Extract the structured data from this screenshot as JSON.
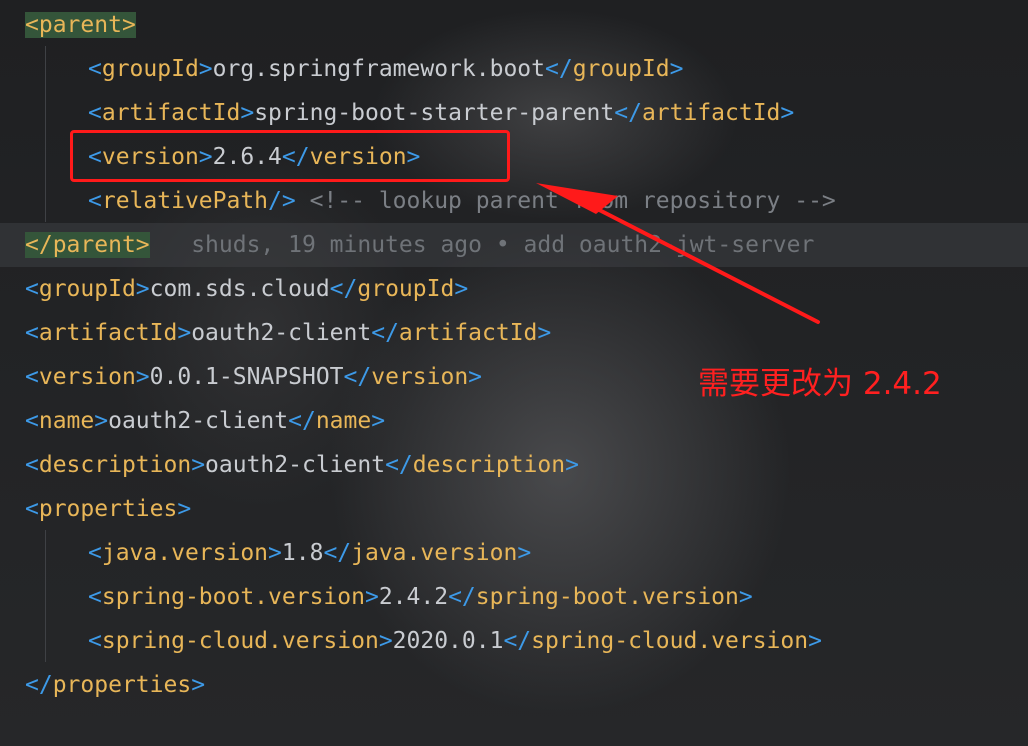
{
  "code_lines": [
    {
      "id": "parent-open",
      "indent": 0,
      "parts": [
        {
          "c": "br-y hl",
          "t": "<"
        },
        {
          "c": "tag hl",
          "t": "parent"
        },
        {
          "c": "br-y hl",
          "t": ">"
        }
      ]
    },
    {
      "id": "groupId",
      "indent": 1,
      "parts": [
        {
          "c": "br",
          "t": "<"
        },
        {
          "c": "tag",
          "t": "groupId"
        },
        {
          "c": "br",
          "t": ">"
        },
        {
          "c": "txt",
          "t": "org.springframework.boot"
        },
        {
          "c": "br",
          "t": "</"
        },
        {
          "c": "tag",
          "t": "groupId"
        },
        {
          "c": "br",
          "t": ">"
        }
      ]
    },
    {
      "id": "artifactId",
      "indent": 1,
      "parts": [
        {
          "c": "br",
          "t": "<"
        },
        {
          "c": "tag",
          "t": "artifactId"
        },
        {
          "c": "br",
          "t": ">"
        },
        {
          "c": "txt",
          "t": "spring-boot-starter-parent"
        },
        {
          "c": "br",
          "t": "</"
        },
        {
          "c": "tag",
          "t": "artifactId"
        },
        {
          "c": "br",
          "t": ">"
        }
      ]
    },
    {
      "id": "version-parent",
      "indent": 1,
      "parts": [
        {
          "c": "br",
          "t": "<"
        },
        {
          "c": "tag",
          "t": "version"
        },
        {
          "c": "br",
          "t": ">"
        },
        {
          "c": "txt",
          "t": "2.6.4"
        },
        {
          "c": "br",
          "t": "</"
        },
        {
          "c": "tag",
          "t": "version"
        },
        {
          "c": "br",
          "t": ">"
        }
      ]
    },
    {
      "id": "relativePath",
      "indent": 1,
      "parts": [
        {
          "c": "br",
          "t": "<"
        },
        {
          "c": "tag",
          "t": "relativePath"
        },
        {
          "c": "br",
          "t": "/>"
        },
        {
          "c": "cmt",
          "t": " <!-- lookup parent from repository -->"
        }
      ]
    },
    {
      "id": "parent-close",
      "indent": 0,
      "current": true,
      "parts": [
        {
          "c": "br-y hl",
          "t": "</"
        },
        {
          "c": "tag hl",
          "t": "parent"
        },
        {
          "c": "br-y hl",
          "t": ">"
        },
        {
          "c": "blame",
          "t": "   shuds, 19 minutes ago • add oauth2-jwt-server"
        }
      ]
    },
    {
      "id": "groupId-project",
      "indent": 0,
      "parts": [
        {
          "c": "br",
          "t": "<"
        },
        {
          "c": "tag",
          "t": "groupId"
        },
        {
          "c": "br",
          "t": ">"
        },
        {
          "c": "txt",
          "t": "com.sds.cloud"
        },
        {
          "c": "br",
          "t": "</"
        },
        {
          "c": "tag",
          "t": "groupId"
        },
        {
          "c": "br",
          "t": ">"
        }
      ]
    },
    {
      "id": "artifactId-project",
      "indent": 0,
      "parts": [
        {
          "c": "br",
          "t": "<"
        },
        {
          "c": "tag",
          "t": "artifactId"
        },
        {
          "c": "br",
          "t": ">"
        },
        {
          "c": "txt",
          "t": "oauth2-client"
        },
        {
          "c": "br",
          "t": "</"
        },
        {
          "c": "tag",
          "t": "artifactId"
        },
        {
          "c": "br",
          "t": ">"
        }
      ]
    },
    {
      "id": "version-project",
      "indent": 0,
      "parts": [
        {
          "c": "br",
          "t": "<"
        },
        {
          "c": "tag",
          "t": "version"
        },
        {
          "c": "br",
          "t": ">"
        },
        {
          "c": "txt",
          "t": "0.0.1-SNAPSHOT"
        },
        {
          "c": "br",
          "t": "</"
        },
        {
          "c": "tag",
          "t": "version"
        },
        {
          "c": "br",
          "t": ">"
        }
      ]
    },
    {
      "id": "name",
      "indent": 0,
      "parts": [
        {
          "c": "br",
          "t": "<"
        },
        {
          "c": "tag",
          "t": "name"
        },
        {
          "c": "br",
          "t": ">"
        },
        {
          "c": "txt",
          "t": "oauth2-client"
        },
        {
          "c": "br",
          "t": "</"
        },
        {
          "c": "tag",
          "t": "name"
        },
        {
          "c": "br",
          "t": ">"
        }
      ]
    },
    {
      "id": "description",
      "indent": 0,
      "parts": [
        {
          "c": "br",
          "t": "<"
        },
        {
          "c": "tag",
          "t": "description"
        },
        {
          "c": "br",
          "t": ">"
        },
        {
          "c": "txt",
          "t": "oauth2-client"
        },
        {
          "c": "br",
          "t": "</"
        },
        {
          "c": "tag",
          "t": "description"
        },
        {
          "c": "br",
          "t": ">"
        }
      ]
    },
    {
      "id": "properties-open",
      "indent": 0,
      "parts": [
        {
          "c": "br",
          "t": "<"
        },
        {
          "c": "tag",
          "t": "properties"
        },
        {
          "c": "br",
          "t": ">"
        }
      ]
    },
    {
      "id": "java-version",
      "indent": 1,
      "parts": [
        {
          "c": "br",
          "t": "<"
        },
        {
          "c": "tag",
          "t": "java.version"
        },
        {
          "c": "br",
          "t": ">"
        },
        {
          "c": "txt",
          "t": "1.8"
        },
        {
          "c": "br",
          "t": "</"
        },
        {
          "c": "tag",
          "t": "java.version"
        },
        {
          "c": "br",
          "t": ">"
        }
      ]
    },
    {
      "id": "spring-boot-version",
      "indent": 1,
      "parts": [
        {
          "c": "br",
          "t": "<"
        },
        {
          "c": "tag",
          "t": "spring-boot.version"
        },
        {
          "c": "br",
          "t": ">"
        },
        {
          "c": "txt",
          "t": "2.4.2"
        },
        {
          "c": "br",
          "t": "</"
        },
        {
          "c": "tag",
          "t": "spring-boot.version"
        },
        {
          "c": "br",
          "t": ">"
        }
      ]
    },
    {
      "id": "spring-cloud-version",
      "indent": 1,
      "parts": [
        {
          "c": "br",
          "t": "<"
        },
        {
          "c": "tag",
          "t": "spring-cloud.version"
        },
        {
          "c": "br",
          "t": ">"
        },
        {
          "c": "txt",
          "t": "2020.0.1"
        },
        {
          "c": "br",
          "t": "</"
        },
        {
          "c": "tag",
          "t": "spring-cloud.version"
        },
        {
          "c": "br",
          "t": ">"
        }
      ]
    },
    {
      "id": "properties-close",
      "indent": 0,
      "parts": [
        {
          "c": "br",
          "t": "</"
        },
        {
          "c": "tag",
          "t": "properties"
        },
        {
          "c": "br",
          "t": ">"
        }
      ]
    }
  ],
  "annotation": {
    "text": "需要更改为 2.4.2",
    "color": "#ff2020"
  },
  "colors": {
    "tag": "#e8b658",
    "bracket": "#3d9ae8",
    "text": "#c9ccd1",
    "comment": "#7b7f85",
    "highlight": "#34553a"
  }
}
